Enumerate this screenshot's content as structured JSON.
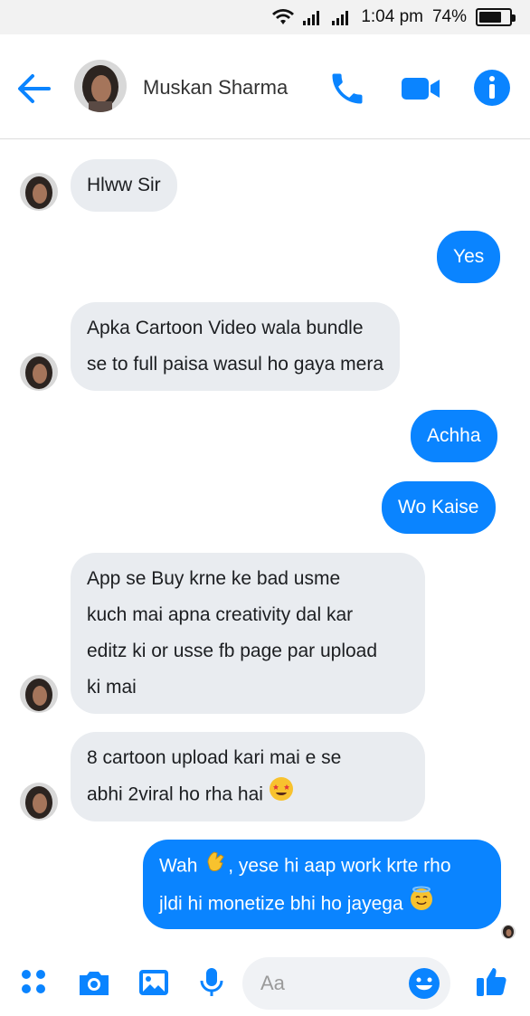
{
  "status": {
    "time": "1:04 pm",
    "battery_text": "74%",
    "battery_level": 0.74
  },
  "header": {
    "contact_name": "Muskan Sharma",
    "icons": [
      "back-arrow-icon",
      "phone-icon",
      "video-camera-icon",
      "info-icon"
    ]
  },
  "messages": [
    {
      "direction": "in",
      "lines": [
        "Hlww Sir"
      ],
      "avatar": true
    },
    {
      "direction": "out",
      "lines": [
        "Yes"
      ]
    },
    {
      "direction": "in",
      "lines": [
        "Apka Cartoon Video wala bundle",
        "se to full paisa wasul ho gaya mera"
      ],
      "avatar": true
    },
    {
      "direction": "out",
      "lines": [
        "Achha"
      ]
    },
    {
      "direction": "out",
      "lines": [
        "Wo Kaise"
      ]
    },
    {
      "direction": "in",
      "lines": [
        "App se Buy krne ke bad usme",
        "kuch mai apna creativity dal kar",
        "editz ki or usse fb page par upload",
        "ki mai"
      ],
      "avatar": true
    },
    {
      "direction": "in",
      "lines": [
        "8 cartoon upload kari mai e se",
        "abhi 2viral ho rha hai"
      ],
      "emoji_end": "star-struck-emoji",
      "avatar": true
    },
    {
      "direction": "out",
      "lines": [
        "Wah",
        ", yese hi aap work krte rho",
        "jldi hi monetize bhi ho jayega"
      ],
      "emojis": [
        "clapping-hands-emoji",
        "smiling-halo-emoji"
      ]
    }
  ],
  "composer": {
    "placeholder": "Aa"
  },
  "colors": {
    "accent": "#0a84ff",
    "incoming_bubble": "#e9ecf0"
  }
}
